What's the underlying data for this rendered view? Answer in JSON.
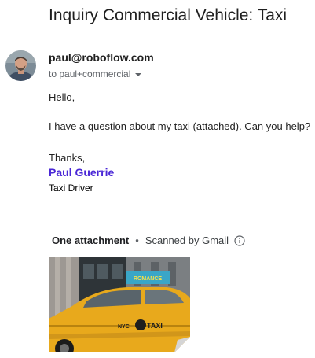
{
  "email": {
    "subject": "Inquiry Commercial Vehicle: Taxi",
    "sender": "paul@roboflow.com",
    "recipient": "to paul+commercial",
    "body": {
      "greeting": "Hello,",
      "message": "I have a question about my taxi (attached). Can you help?",
      "closing": "Thanks,"
    },
    "signature": {
      "name": "Paul Guerrie",
      "title": "Taxi Driver",
      "name_color": "#4a27d6"
    }
  },
  "attachments": {
    "count_label": "One attachment",
    "separator": "•",
    "scan_label": "Scanned by Gmail",
    "info_icon": "info-icon",
    "items": [
      {
        "type": "image",
        "sign_text": "ROMANCE",
        "taxi_text": "TAXI",
        "nyc_text": "NYC"
      }
    ]
  },
  "colors": {
    "taxi_yellow": "#e8a91c",
    "link_purple": "#4a27d6",
    "text_gray": "#5f6368"
  }
}
